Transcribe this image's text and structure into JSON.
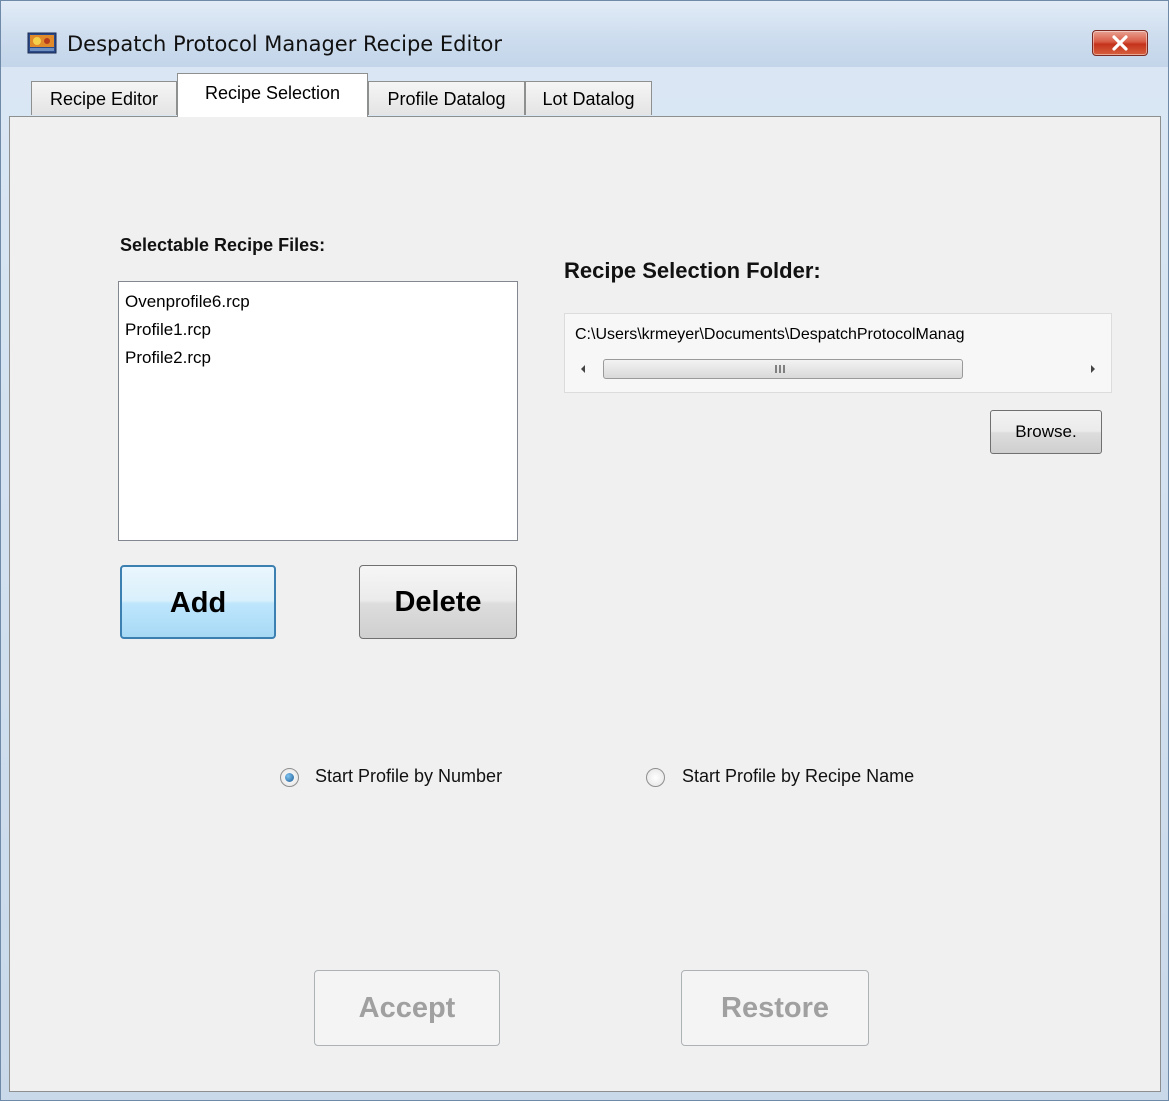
{
  "window": {
    "title": "Despatch Protocol Manager Recipe Editor"
  },
  "tabs": [
    {
      "label": "Recipe Editor",
      "active": false
    },
    {
      "label": "Recipe Selection",
      "active": true
    },
    {
      "label": "Profile Datalog",
      "active": false
    },
    {
      "label": "Lot Datalog",
      "active": false
    }
  ],
  "recipe_files": {
    "heading": "Selectable Recipe Files:",
    "items": [
      "Ovenprofile6.rcp",
      "Profile1.rcp",
      "Profile2.rcp"
    ],
    "add_label": "Add",
    "delete_label": "Delete"
  },
  "folder": {
    "heading": "Recipe Selection Folder:",
    "path": "C:\\Users\\krmeyer\\Documents\\DespatchProtocolManag",
    "browse_label": "Browse."
  },
  "start_mode": {
    "option_number": "Start Profile by Number",
    "option_recipe": "Start Profile by Recipe Name",
    "selected": "number"
  },
  "actions": {
    "accept_label": "Accept",
    "restore_label": "Restore"
  },
  "colors": {
    "close_button": "#d85b45",
    "focus_border": "#3c7fb1",
    "disabled_text": "#a0a0a0"
  }
}
